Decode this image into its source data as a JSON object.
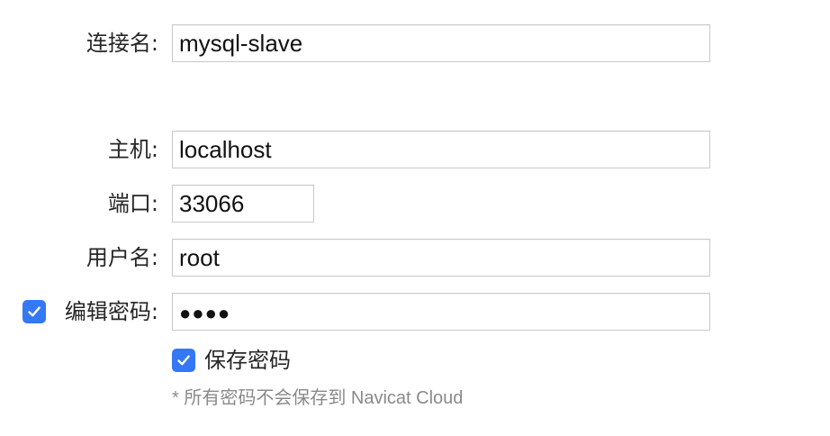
{
  "connection_name": {
    "label": "连接名:",
    "value": "mysql-slave"
  },
  "host": {
    "label": "主机:",
    "value": "localhost"
  },
  "port": {
    "label": "端口:",
    "value": "33066"
  },
  "username": {
    "label": "用户名:",
    "value": "root"
  },
  "password": {
    "edit_checkbox_label": "编辑密码:",
    "edit_checked": true,
    "masked_value": "●●●●"
  },
  "save_password": {
    "label": "保存密码",
    "checked": true
  },
  "note": "* 所有密码不会保存到 Navicat Cloud",
  "colors": {
    "accent": "#3478f6",
    "field_border": "#c9c9c9",
    "note_text": "#8a8a8a"
  }
}
